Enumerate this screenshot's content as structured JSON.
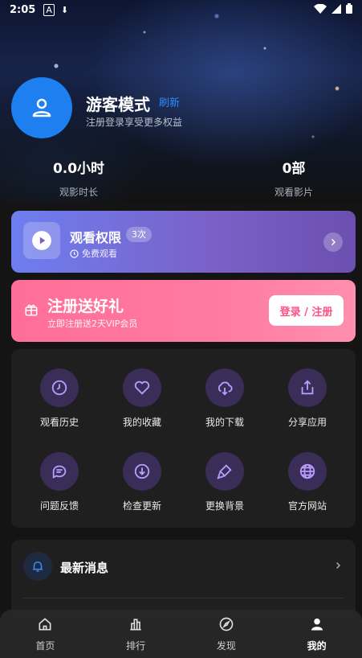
{
  "status_bar": {
    "time": "2:05",
    "left_icons": [
      "A",
      "download-arrow"
    ],
    "right_icons": [
      "wifi",
      "signal",
      "battery"
    ]
  },
  "profile": {
    "name": "游客模式",
    "tag": "刷新",
    "subtitle": "注册登录享受更多权益"
  },
  "stats": [
    {
      "value": "0.0小时",
      "label": "观影时长"
    },
    {
      "value": "0部",
      "label": "观看影片"
    }
  ],
  "permission": {
    "title": "观看权限",
    "badge": "3次",
    "subtitle": "免费观看"
  },
  "register": {
    "title": "注册送好礼",
    "subtitle": "立即注册送2天VIP会员",
    "button_label": "登录 / 注册"
  },
  "grid": [
    {
      "label": "观看历史",
      "icon": "clock-icon"
    },
    {
      "label": "我的收藏",
      "icon": "heart-icon"
    },
    {
      "label": "我的下载",
      "icon": "cloud-download-icon"
    },
    {
      "label": "分享应用",
      "icon": "share-icon"
    },
    {
      "label": "问题反馈",
      "icon": "chat-icon"
    },
    {
      "label": "检查更新",
      "icon": "download-circle-icon"
    },
    {
      "label": "更换背景",
      "icon": "brush-icon"
    },
    {
      "label": "官方网站",
      "icon": "globe-icon"
    }
  ],
  "news": {
    "title": "最新消息"
  },
  "nav": [
    {
      "label": "首页",
      "icon": "home-icon"
    },
    {
      "label": "排行",
      "icon": "chart-icon"
    },
    {
      "label": "发现",
      "icon": "compass-icon"
    },
    {
      "label": "我的",
      "icon": "user-icon",
      "active": true
    }
  ],
  "colors": {
    "accent_blue": "#1e7ff0",
    "grid_circle": "#3a2d58",
    "register_pink": "#ff6e99",
    "permission_purple": "#7a60c6"
  }
}
